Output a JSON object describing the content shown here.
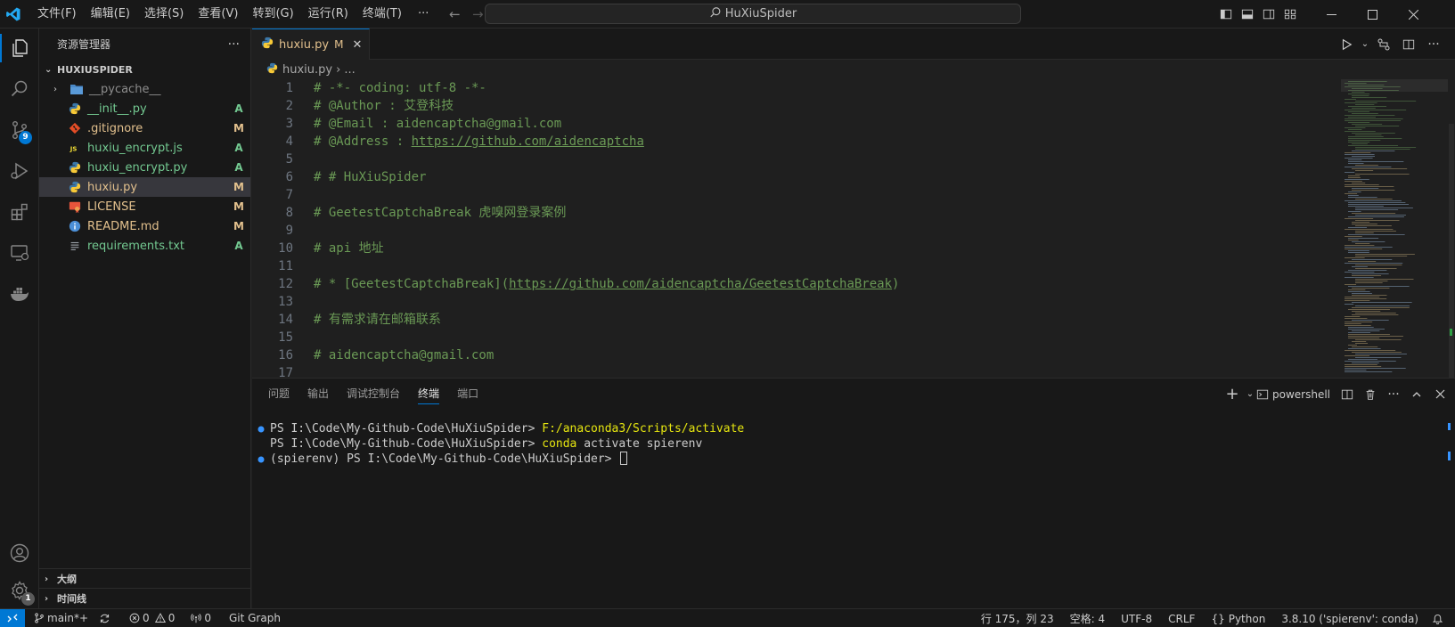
{
  "titlebar": {
    "menus": [
      "文件(F)",
      "编辑(E)",
      "选择(S)",
      "查看(V)",
      "转到(G)",
      "运行(R)",
      "终端(T)"
    ],
    "more": "···",
    "command_center": "HuXiuSpider"
  },
  "activity_bar": {
    "source_control_badge": "9",
    "settings_badge": "1"
  },
  "sidebar": {
    "title": "资源管理器",
    "more": "···",
    "root_folder": "HUXIUSPIDER",
    "items": [
      {
        "name": "__pycache__",
        "status": "",
        "type": "folder"
      },
      {
        "name": "__init__.py",
        "status": "A",
        "type": "python"
      },
      {
        "name": ".gitignore",
        "status": "M",
        "type": "git"
      },
      {
        "name": "huxiu_encrypt.js",
        "status": "A",
        "type": "js"
      },
      {
        "name": "huxiu_encrypt.py",
        "status": "A",
        "type": "python"
      },
      {
        "name": "huxiu.py",
        "status": "M",
        "type": "python"
      },
      {
        "name": "LICENSE",
        "status": "M",
        "type": "license"
      },
      {
        "name": "README.md",
        "status": "M",
        "type": "info"
      },
      {
        "name": "requirements.txt",
        "status": "A",
        "type": "text"
      }
    ],
    "outline": "大纲",
    "timeline": "时间线"
  },
  "editor": {
    "tab": {
      "name": "huxiu.py",
      "modified": "M",
      "close": "✕"
    },
    "breadcrumb": {
      "file": "huxiu.py",
      "rest": "..."
    },
    "lines": [
      {
        "n": "1",
        "pre": "# -*- coding: utf-8 -*-",
        "url": "",
        "post": ""
      },
      {
        "n": "2",
        "pre": "# @Author : 艾登科技",
        "url": "",
        "post": ""
      },
      {
        "n": "3",
        "pre": "# @Email : aidencaptcha@gmail.com",
        "url": "",
        "post": ""
      },
      {
        "n": "4",
        "pre": "# @Address : ",
        "url": "https://github.com/aidencaptcha",
        "post": ""
      },
      {
        "n": "5",
        "pre": "",
        "url": "",
        "post": ""
      },
      {
        "n": "6",
        "pre": "# # HuXiuSpider",
        "url": "",
        "post": ""
      },
      {
        "n": "7",
        "pre": "",
        "url": "",
        "post": ""
      },
      {
        "n": "8",
        "pre": "# GeetestCaptchaBreak 虎嗅网登录案例",
        "url": "",
        "post": ""
      },
      {
        "n": "9",
        "pre": "",
        "url": "",
        "post": ""
      },
      {
        "n": "10",
        "pre": "# api 地址",
        "url": "",
        "post": ""
      },
      {
        "n": "11",
        "pre": "",
        "url": "",
        "post": ""
      },
      {
        "n": "12",
        "pre": "# * [GeetestCaptchaBreak](",
        "url": "https://github.com/aidencaptcha/GeetestCaptchaBreak",
        "post": ")"
      },
      {
        "n": "13",
        "pre": "",
        "url": "",
        "post": ""
      },
      {
        "n": "14",
        "pre": "# 有需求请在邮箱联系",
        "url": "",
        "post": ""
      },
      {
        "n": "15",
        "pre": "",
        "url": "",
        "post": ""
      },
      {
        "n": "16",
        "pre": "# aidencaptcha@gmail.com",
        "url": "",
        "post": ""
      },
      {
        "n": "17",
        "pre": "",
        "url": "",
        "post": ""
      }
    ]
  },
  "panel": {
    "tabs": [
      "问题",
      "输出",
      "调试控制台",
      "终端",
      "端口"
    ],
    "active_tab": 3,
    "shell": "powershell",
    "terminal_lines": [
      {
        "dot": true,
        "prompt": "PS I:\\Code\\My-Github-Code\\HuXiuSpider> ",
        "cmd": "F:/anaconda3/Scripts/activate",
        "rest": ""
      },
      {
        "dot": false,
        "prompt": "PS I:\\Code\\My-Github-Code\\HuXiuSpider> ",
        "cmd": "conda",
        "rest": " activate spierenv"
      },
      {
        "dot": true,
        "prompt": "(spierenv) PS I:\\Code\\My-Github-Code\\HuXiuSpider> ",
        "cmd": "",
        "rest": ""
      }
    ]
  },
  "statusbar": {
    "branch": "main*+",
    "errors": "0",
    "warnings": "0",
    "ports": "0",
    "git_graph": "Git Graph",
    "position": "行 175，列 23",
    "spaces": "空格: 4",
    "encoding": "UTF-8",
    "eol": "CRLF",
    "language": "Python",
    "interpreter": "3.8.10 ('spierenv': conda)"
  },
  "colors": {
    "accent": "#0078d4",
    "modified": "#e2c08d",
    "added": "#73c991",
    "comment": "#6a9955",
    "terminal_cmd": "#e5e510"
  }
}
